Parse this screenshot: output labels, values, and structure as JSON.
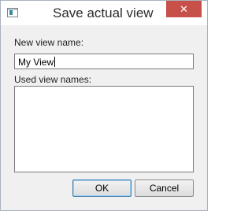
{
  "window": {
    "title": "Save actual view",
    "close_label": "✕"
  },
  "form": {
    "new_view_label": "New view name:",
    "new_view_value": "My View",
    "used_names_label": "Used view names:",
    "used_names": []
  },
  "buttons": {
    "ok_label": "OK",
    "cancel_label": "Cancel"
  }
}
